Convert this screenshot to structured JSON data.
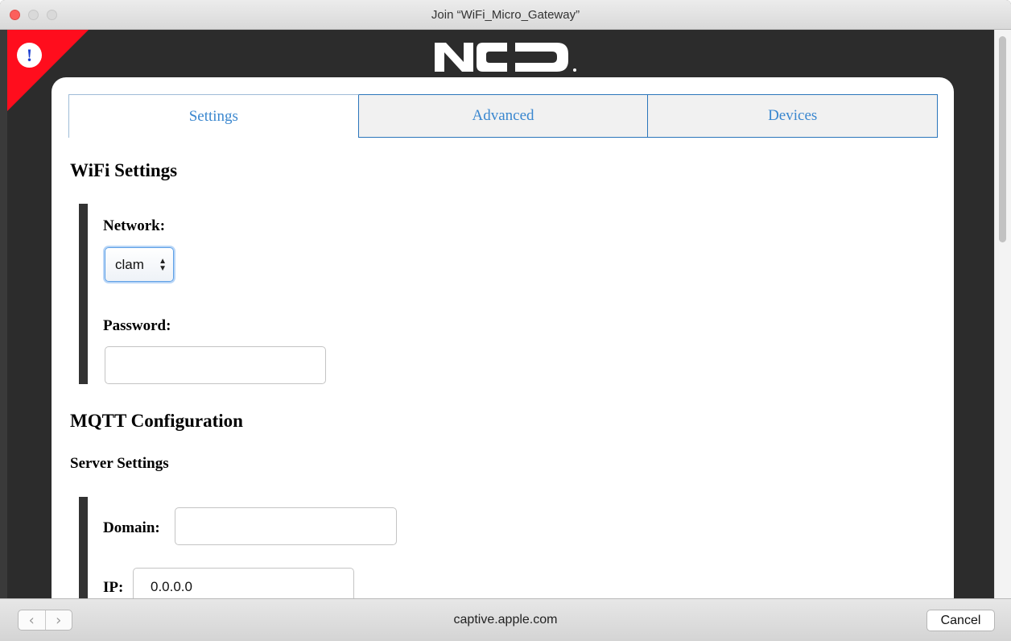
{
  "window": {
    "title": "Join “WiFi_Micro_Gateway”"
  },
  "warning": {
    "symbol": "!",
    "flag_color": "#ff0d1d"
  },
  "logo": {
    "text": "NCD"
  },
  "tabs": [
    {
      "label": "Settings",
      "selected": true
    },
    {
      "label": "Advanced",
      "selected": false
    },
    {
      "label": "Devices",
      "selected": false
    }
  ],
  "wifi": {
    "heading": "WiFi Settings",
    "network_label": "Network:",
    "network_value": "clam",
    "password_label": "Password:",
    "password_value": ""
  },
  "mqtt": {
    "heading": "MQTT Configuration",
    "subheading": "Server Settings",
    "domain_label": "Domain:",
    "domain_value": "",
    "ip_label": "IP:",
    "ip_value": "0.0.0.0"
  },
  "bottombar": {
    "back_icon": "‹",
    "forward_icon": "›",
    "url": "captive.apple.com",
    "cancel_label": "Cancel"
  },
  "colors": {
    "tab_text": "#3a87cf",
    "tab_border": "#2a75bb",
    "close_light": "#fc605c"
  }
}
